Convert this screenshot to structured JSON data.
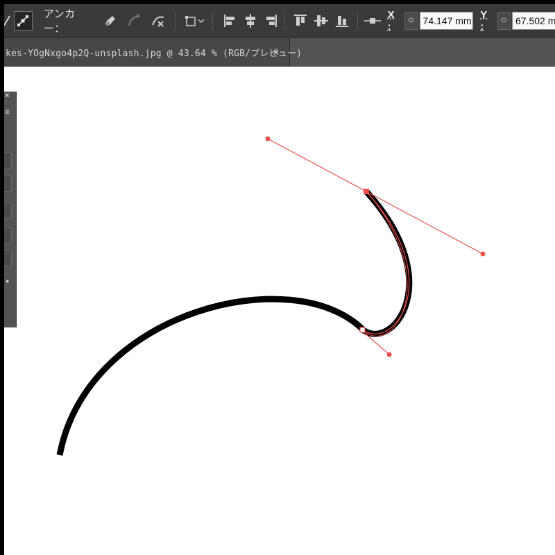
{
  "control_bar": {
    "anchor_label": "アンカー：",
    "x_label": "X :",
    "x_value": "74.147 mm",
    "y_label": "Y :",
    "y_value": "67.502 mm",
    "icons": [
      "direct-selection-icon",
      "convert-anchor-icon",
      "pen-icon",
      "smooth-anchor-icon",
      "cut-path-icon",
      "transform-icon",
      "align-left-icon",
      "align-horizontal-center-icon",
      "align-right-icon",
      "align-top-icon",
      "align-vertical-center-icon",
      "align-bottom-icon",
      "anchor-point-icon"
    ]
  },
  "document_tab": {
    "title": "kes-YOgNxgo4p2Q-unsplash.jpg @ 43.64 % (RGB/プレビュー)",
    "close_label": "×"
  },
  "tool_panel": {
    "close_label": "×",
    "menu_label": "≡"
  },
  "canvas": {
    "stroke_color": "#000000",
    "path_highlight_color": "#e8504b"
  }
}
